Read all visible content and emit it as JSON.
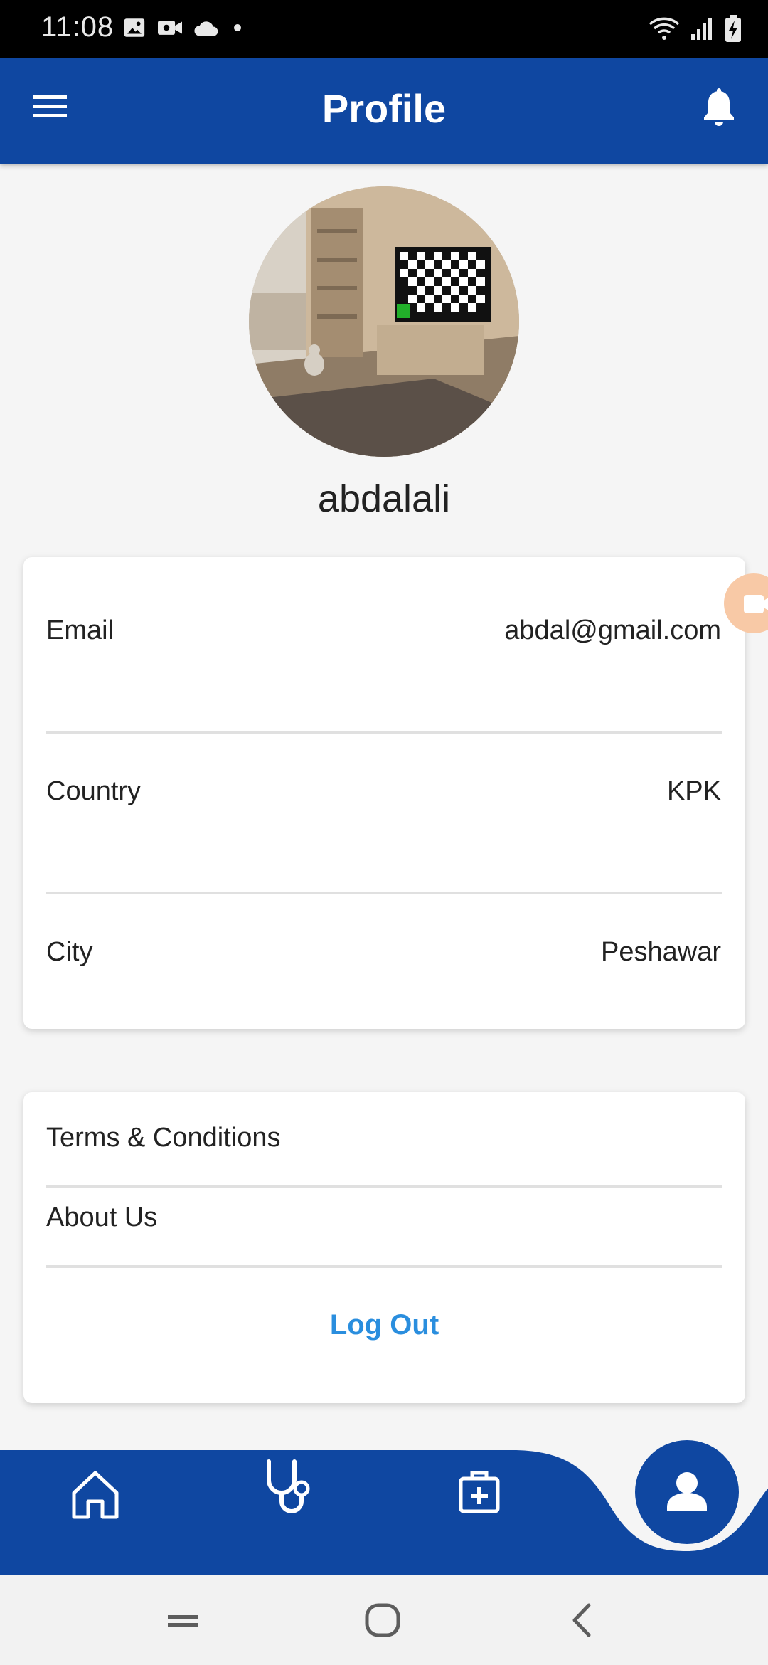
{
  "status_bar": {
    "time": "11:08",
    "left_icons": [
      "image-icon",
      "video-icon",
      "cloud-icon",
      "dot-icon"
    ],
    "right_icons": [
      "wifi-icon",
      "signal-icon",
      "battery-charging-icon"
    ]
  },
  "app_bar": {
    "title": "Profile",
    "left_icon": "menu-icon",
    "right_icon": "bell-icon",
    "color": "#0f47a1"
  },
  "profile": {
    "username": "abdalali",
    "avatar_icon": "room-photo"
  },
  "info_card": {
    "rows": [
      {
        "label": "Email",
        "value": "abdal@gmail.com"
      },
      {
        "label": "Country",
        "value": "KPK"
      },
      {
        "label": "City",
        "value": "Peshawar"
      }
    ]
  },
  "links_card": {
    "terms": "Terms & Conditions",
    "about": "About Us",
    "logout": "Log Out",
    "logout_color": "#2a8ede"
  },
  "bottom_nav": {
    "items": [
      "home-icon",
      "stethoscope-icon",
      "medical-kit-icon",
      "person-icon"
    ],
    "active": "person-icon"
  },
  "system_nav": {
    "items": [
      "recents-icon",
      "home-circle-icon",
      "back-icon"
    ]
  }
}
